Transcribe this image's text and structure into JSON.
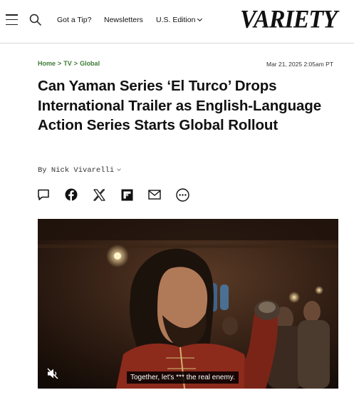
{
  "header": {
    "tip_label": "Got a Tip?",
    "newsletters_label": "Newsletters",
    "edition_label": "U.S. Edition",
    "logo_text": "VARIETY"
  },
  "article": {
    "breadcrumb": [
      "Home",
      "TV",
      "Global"
    ],
    "breadcrumb_separator": ">",
    "timestamp": "Mar 21, 2025 2:05am PT",
    "headline": "Can Yaman Series ‘El Turco’ Drops International Trailer as English-Language Action Series Starts Global Rollout",
    "byline_prefix": "By",
    "author": "Nick Vivarelli"
  },
  "share_icons": [
    "comment-icon",
    "facebook-icon",
    "x-icon",
    "flipboard-icon",
    "email-icon",
    "more-icon"
  ],
  "video": {
    "caption": "Together, let's *** the real enemy.",
    "muted": true
  },
  "colors": {
    "breadcrumb_green": "#3e7a36",
    "text": "#111111",
    "caption_bg": "#000000"
  }
}
